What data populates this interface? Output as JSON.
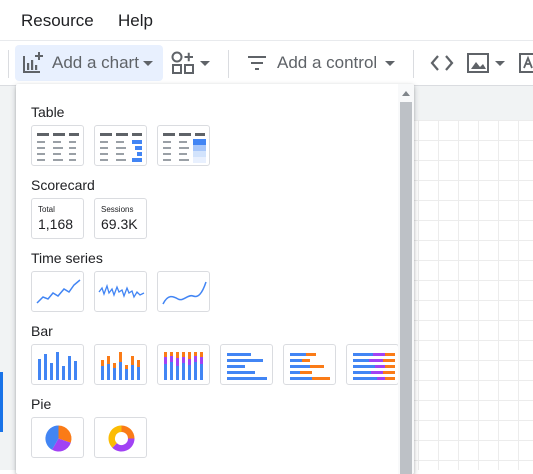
{
  "menubar": {
    "items": [
      "Resource",
      "Help"
    ]
  },
  "toolbar": {
    "add_chart": {
      "label": "Add a chart",
      "icon": "add-chart-icon"
    },
    "community": {
      "icon": "community-visualizations-icon"
    },
    "add_control": {
      "label": "Add a control",
      "icon": "filter-icon"
    },
    "embed": {
      "icon": "code-icon"
    },
    "image": {
      "icon": "image-icon"
    },
    "text": {
      "icon": "text-icon"
    }
  },
  "chart_menu": {
    "sections": {
      "table": "Table",
      "scorecard": "Scorecard",
      "timeseries": "Time series",
      "bar": "Bar",
      "pie": "Pie"
    },
    "scorecards": [
      {
        "label": "Total",
        "value": "1,168"
      },
      {
        "label": "Sessions",
        "value": "69.3K"
      }
    ]
  },
  "colors": {
    "accent": "#1a73e8",
    "blue": "#4285f4",
    "orange": "#fa7b17",
    "purple": "#a142f4"
  }
}
